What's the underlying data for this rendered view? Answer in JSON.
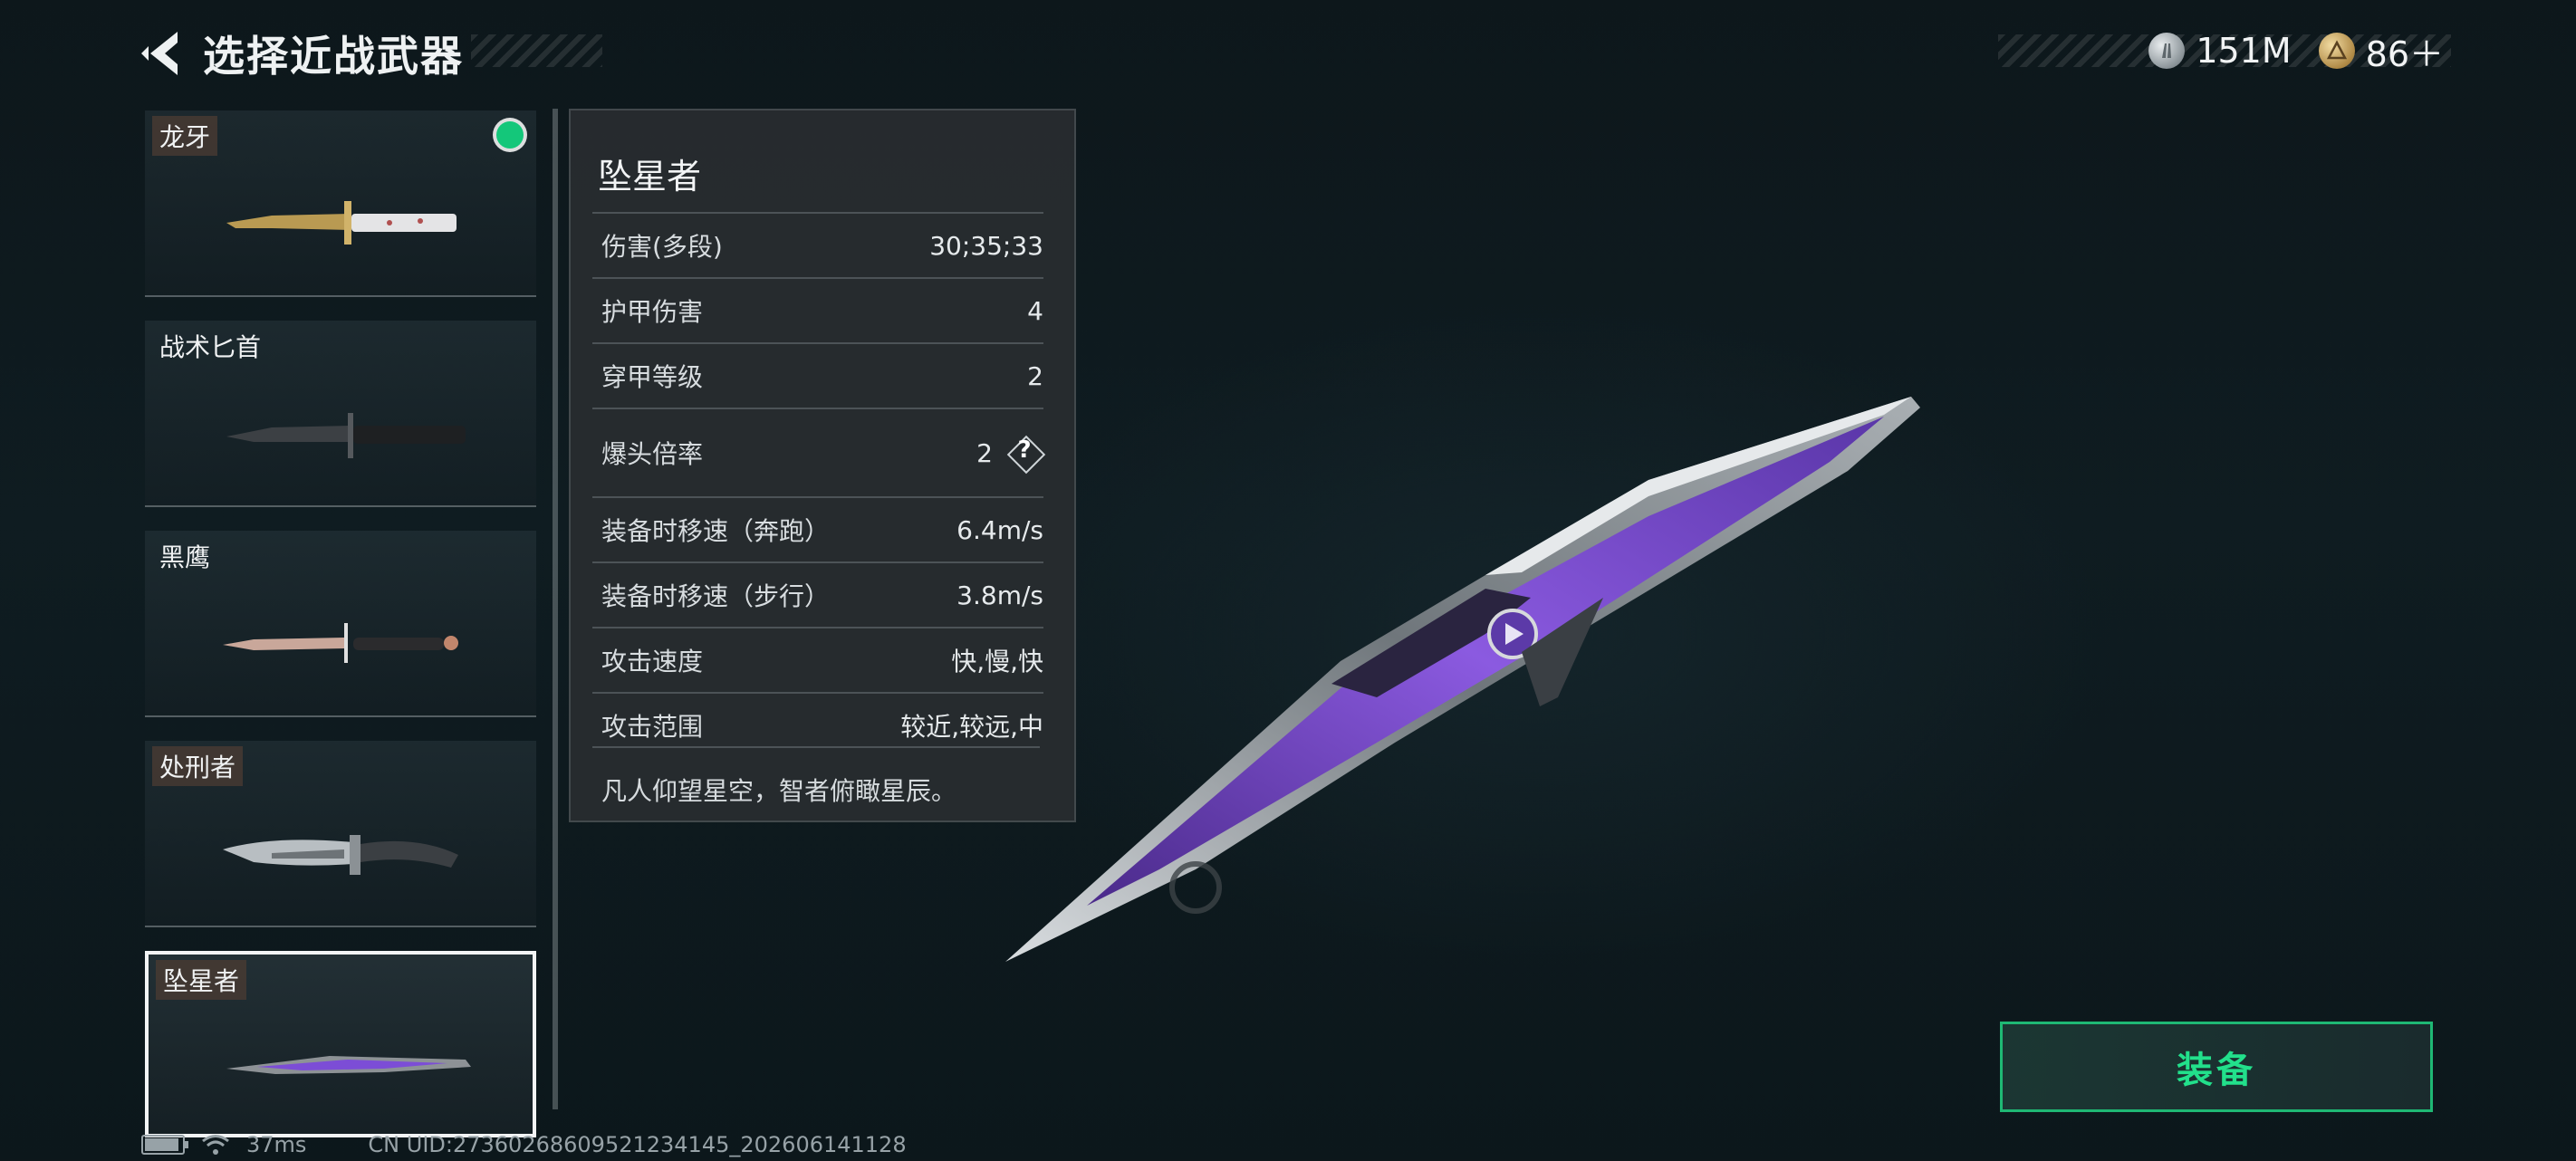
{
  "header": {
    "title": "选择近战武器"
  },
  "currency": {
    "silver": "151M",
    "gold": "86＋"
  },
  "weapons": [
    {
      "name": "龙牙",
      "tagged": true,
      "equipped": true
    },
    {
      "name": "战术匕首",
      "tagged": false,
      "equipped": false
    },
    {
      "name": "黑鹰",
      "tagged": false,
      "equipped": false
    },
    {
      "name": "处刑者",
      "tagged": true,
      "equipped": false
    },
    {
      "name": "坠星者",
      "tagged": true,
      "equipped": false,
      "selected": true
    }
  ],
  "details": {
    "name": "坠星者",
    "stats": [
      {
        "label": "伤害(多段)",
        "value": "30;35;33"
      },
      {
        "label": "护甲伤害",
        "value": "4"
      },
      {
        "label": "穿甲等级",
        "value": "2"
      },
      {
        "label": "爆头倍率",
        "value": "2",
        "help": true
      },
      {
        "label": "装备时移速（奔跑）",
        "value": "6.4m/s"
      },
      {
        "label": "装备时移速（步行）",
        "value": "3.8m/s"
      },
      {
        "label": "攻击速度",
        "value": "快,慢,快"
      },
      {
        "label": "攻击范围",
        "value": "较近,较远,中"
      }
    ],
    "description": "凡人仰望星空，智者俯瞰星辰。"
  },
  "help_icon_text": "?",
  "equip_button": {
    "label": "装备"
  },
  "status": {
    "battery_level": 0.85,
    "ping": "37ms",
    "uid": "CN UID:2736026860952123414​5_202606141128"
  },
  "colors": {
    "accent_green": "#22e08b",
    "equipped_dot": "#14c77a",
    "blade_purple": "#7c4dd6"
  },
  "icons": [
    "back-chevron-icon",
    "silver-coin-icon",
    "gold-coin-icon",
    "help-diamond-icon",
    "battery-icon",
    "wifi-icon"
  ]
}
